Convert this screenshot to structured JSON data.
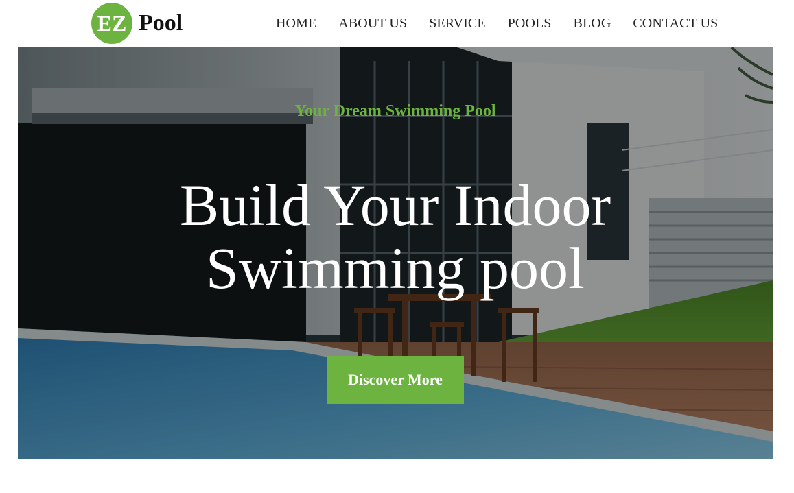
{
  "brand": {
    "badge": "EZ",
    "name": "Pool"
  },
  "nav": {
    "items": [
      "HOME",
      "ABOUT US",
      "SERVICE",
      "POOLS",
      "BLOG",
      "CONTACT US"
    ]
  },
  "hero": {
    "kicker": "Your Dream Swimming Pool",
    "title_line1": "Build Your Indoor",
    "title_line2": "Swimming pool",
    "cta_label": "Discover More",
    "background_image": "house-with-pool-and-deck-photo"
  },
  "colors": {
    "accent": "#6db33f",
    "nav_text": "#222222",
    "title_text": "#ffffff"
  }
}
